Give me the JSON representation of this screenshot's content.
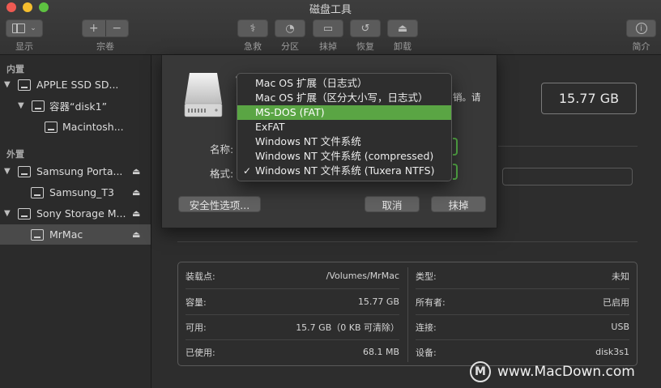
{
  "window": {
    "title": "磁盘工具"
  },
  "toolbar": {
    "display_label": "显示",
    "volume_label": "宗卷",
    "rescue_label": "急救",
    "partition_label": "分区",
    "erase_label": "抹掉",
    "restore_label": "恢复",
    "unmount_label": "卸载",
    "info_label": "简介"
  },
  "sidebar": {
    "internal_header": "内置",
    "external_header": "外置",
    "items": [
      {
        "label": "APPLE SSD SD..."
      },
      {
        "label": "容器“disk1”"
      },
      {
        "label": "Macintosh..."
      },
      {
        "label": "Samsung Porta..."
      },
      {
        "label": "Samsung_T3"
      },
      {
        "label": "Sony Storage M..."
      },
      {
        "label": "MrMac"
      }
    ]
  },
  "main": {
    "capacity": "15.77 GB",
    "info": {
      "mount_point_key": "装载点:",
      "mount_point_val": "/Volumes/MrMac",
      "capacity_key": "容量:",
      "capacity_val": "15.77 GB",
      "available_key": "可用:",
      "available_val": "15.7 GB（0 KB 可清除）",
      "used_key": "已使用:",
      "used_val": "68.1 MB",
      "type_key": "类型:",
      "type_val": "未知",
      "owner_key": "所有者:",
      "owner_val": "已启用",
      "connection_key": "连接:",
      "connection_val": "USB",
      "device_key": "设备:",
      "device_val": "disk3s1"
    }
  },
  "sheet": {
    "text_fragment_1": "销。请",
    "text_fragment_2": "。",
    "name_label": "名称:",
    "format_label": "格式:",
    "security_button": "安全性选项...",
    "cancel_button": "取消",
    "erase_button": "抹掉"
  },
  "format_menu": {
    "items": [
      "Mac OS 扩展（日志式）",
      "Mac OS 扩展（区分大小写，日志式）",
      "MS-DOS (FAT)",
      "ExFAT",
      "Windows NT 文件系统",
      "Windows NT 文件系统 (compressed)",
      "Windows NT 文件系统 (Tuxera NTFS)"
    ],
    "highlighted": "MS-DOS (FAT)",
    "checked": "Windows NT 文件系统 (Tuxera NTFS)",
    "highlight_color": "#5aa544"
  },
  "watermark": {
    "text": "www.MacDown.com"
  }
}
